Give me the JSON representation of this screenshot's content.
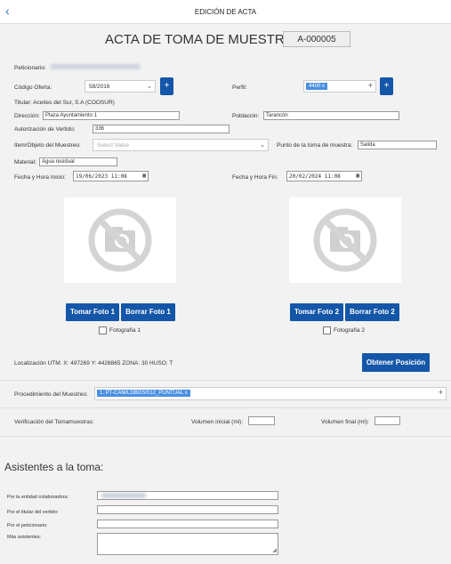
{
  "header": {
    "title": "EDICIÓN DE ACTA",
    "back_icon": "‹"
  },
  "acta": {
    "title": "ACTA DE TOMA DE MUESTRA",
    "number": "A-000005"
  },
  "form": {
    "peticionario_label": "Peticionario:",
    "codigo_oferta_label": "Código Oferta:",
    "codigo_oferta_value": "58/2016",
    "perfil_label": "Perfil:",
    "perfil_tag": "4400 x",
    "titular_label": "Titular: Aceites del Sur, S.A (COOSUR)",
    "direccion_label": "Dirección:",
    "direccion_value": "Plaza Ayuntamiento 1",
    "poblacion_label": "Población:",
    "poblacion_value": "Tarancón",
    "autorizacion_label": "Autorización de Vertido:",
    "autorizacion_value": "336",
    "item_label": "Item/Objeto del Muestreo:",
    "item_placeholder": "Select Value",
    "punto_label": "Punto de la toma de muestra:",
    "punto_value": "Salida",
    "material_label": "Material:",
    "material_value": "Agua residual",
    "fecha_inicio_label": "Fecha y Hora Inicio:",
    "fecha_inicio_value": "19/06/2023  11:08",
    "fecha_fin_label": "Fecha y Hora Fin:",
    "fecha_fin_value": "20/02/2024  11:08"
  },
  "photos": {
    "take1": "Tomar Foto 1",
    "delete1": "Borrar Foto 1",
    "check1": "Fotografía 1",
    "take2": "Tomar Foto 2",
    "delete2": "Borrar Foto 2",
    "check2": "Fotografía 2"
  },
  "location": {
    "text": "Localización UTM: X: 497269 Y: 4428865 ZONA: 30 HUSO: T",
    "button": "Obtener Posición"
  },
  "procedimiento": {
    "label": "Procedimiento del Muestreo:",
    "tag": "1. PT-CAM/LDBOS/012_PUNTUAL x",
    "plus": "+"
  },
  "verificacion": {
    "label": "Verificación del Tomamuestras:",
    "vol_inicial_label": "Volumen inicial (ml):",
    "vol_final_label": "Volumen final (ml):"
  },
  "asistentes": {
    "title": "Asistentes a la toma:",
    "entidad_label": "Por la entidad colaboradora:",
    "titular_label": "Por el titular del vertido:",
    "peticionario_label": "Por el peticionario:",
    "mas_label": "Más asistentes:"
  },
  "colors": {
    "primary": "#1456a8",
    "tag": "#4a90e2",
    "background": "#f2f2f2"
  }
}
